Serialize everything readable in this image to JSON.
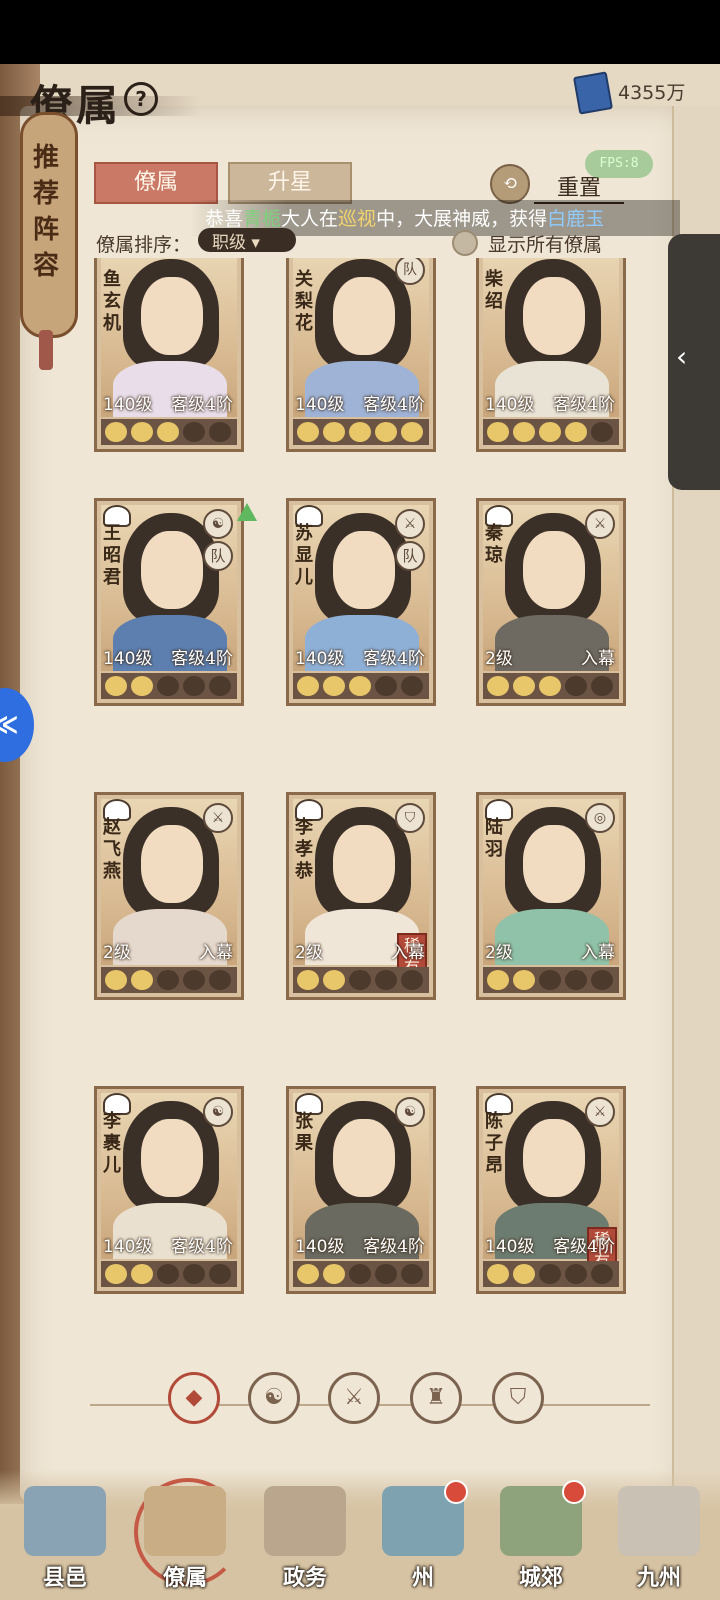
{
  "header": {
    "title": "僚属",
    "help_symbol": "?",
    "currency_value": "4355万"
  },
  "side_scroll": {
    "label": "推荐阵容"
  },
  "tabs": [
    {
      "label": "僚属",
      "active": true
    },
    {
      "label": "升星",
      "active": false
    }
  ],
  "reset": {
    "label": "重置"
  },
  "fps": {
    "label": "FPS:8"
  },
  "banner": {
    "prefix": "恭喜",
    "name": "青栀",
    "mid1": "大人在",
    "place": "巡视",
    "mid2": "中，大展神威，获得",
    "reward": "白鹿玉"
  },
  "sort": {
    "label": "僚属排序：",
    "value": "职级 ▾"
  },
  "show_all": {
    "label": "显示所有僚属"
  },
  "cards": [
    {
      "name": "鱼玄机",
      "level": "140级",
      "rank": "客级4阶",
      "badge": "",
      "team": "",
      "rare": "",
      "stars": 3,
      "body": "#e8dde8"
    },
    {
      "name": "关梨花",
      "level": "140级",
      "rank": "客级4阶",
      "badge": "队",
      "team": "",
      "rare": "",
      "stars": 5,
      "body": "#9fb3d6"
    },
    {
      "name": "柴绍",
      "level": "140级",
      "rank": "客级4阶",
      "badge": "",
      "team": "",
      "rare": "",
      "stars": 4,
      "body": "#e9e3d6"
    },
    {
      "name": "王昭君",
      "level": "140级",
      "rank": "客级4阶",
      "badge": "☯",
      "team": "队",
      "rare": "",
      "stars": 2,
      "body": "#5c7fb0"
    },
    {
      "name": "苏显儿",
      "level": "140级",
      "rank": "客级4阶",
      "badge": "⚔",
      "team": "队",
      "rare": "",
      "stars": 3,
      "body": "#8fb0d6"
    },
    {
      "name": "秦琼",
      "level": "2级",
      "rank": "入幕",
      "badge": "⚔",
      "team": "",
      "rare": "",
      "stars": 3,
      "body": "#6e6a62"
    },
    {
      "name": "赵飞燕",
      "level": "2级",
      "rank": "入幕",
      "badge": "⚔",
      "team": "",
      "rare": "",
      "stars": 2,
      "body": "#e5d8cc"
    },
    {
      "name": "李孝恭",
      "level": "2级",
      "rank": "入幕",
      "badge": "⛉",
      "team": "",
      "rare": "稀有",
      "stars": 2,
      "body": "#f0e6d8"
    },
    {
      "name": "陆羽",
      "level": "2级",
      "rank": "入幕",
      "badge": "◎",
      "team": "",
      "rare": "",
      "stars": 2,
      "body": "#8fc2a8"
    },
    {
      "name": "李裹儿",
      "level": "140级",
      "rank": "客级4阶",
      "badge": "☯",
      "team": "",
      "rare": "",
      "stars": 2,
      "body": "#e9e0cf"
    },
    {
      "name": "张果",
      "level": "140级",
      "rank": "客级4阶",
      "badge": "☯",
      "team": "",
      "rare": "",
      "stars": 2,
      "body": "#6a6a60"
    },
    {
      "name": "陈子昂",
      "level": "140级",
      "rank": "客级4阶",
      "badge": "⚔",
      "team": "",
      "rare": "稀有",
      "stars": 2,
      "body": "#6d7c70"
    }
  ],
  "filters": [
    "◆",
    "☯",
    "⚔",
    "♜",
    "⛉"
  ],
  "nav": [
    {
      "label": "县邑",
      "icon": "gate-icon",
      "dot": false
    },
    {
      "label": "僚属",
      "icon": "scroll-icon",
      "dot": false
    },
    {
      "label": "政务",
      "icon": "document-icon",
      "dot": false
    },
    {
      "label": "州",
      "icon": "mountain-icon",
      "dot": true
    },
    {
      "label": "城郊",
      "icon": "field-icon",
      "dot": true
    },
    {
      "label": "九州",
      "icon": "map-icon",
      "dot": false
    }
  ]
}
